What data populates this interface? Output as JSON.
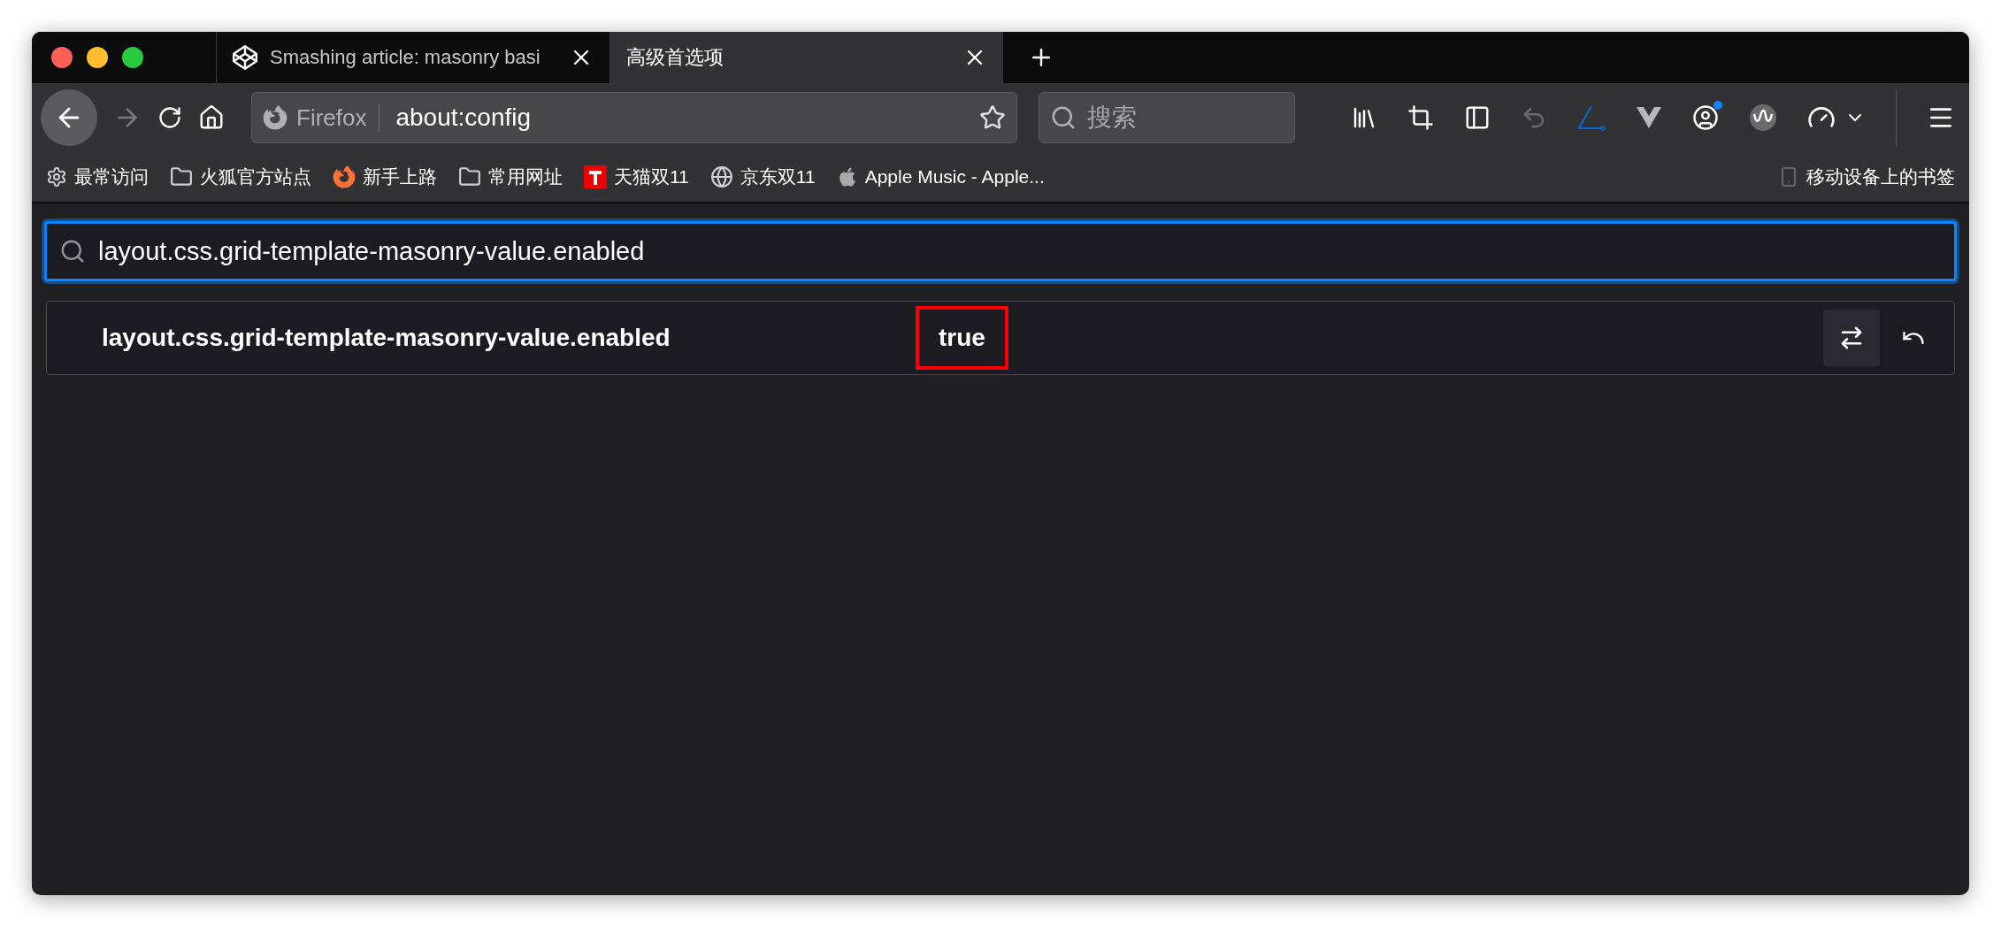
{
  "tabs": [
    {
      "title": "Smashing article: masonry basi",
      "selected": false,
      "kind": "codepen"
    },
    {
      "title": "高级首选项",
      "selected": true,
      "kind": "plain"
    }
  ],
  "url_bar": {
    "identity": "Firefox",
    "url": "about:config"
  },
  "search": {
    "placeholder": "搜索"
  },
  "bookmarks": [
    {
      "label": "最常访问",
      "kind": "settings"
    },
    {
      "label": "火狐官方站点",
      "kind": "folder"
    },
    {
      "label": "新手上路",
      "kind": "firefox"
    },
    {
      "label": "常用网址",
      "kind": "folder"
    },
    {
      "label": "天猫双11",
      "kind": "tmall"
    },
    {
      "label": "京东双11",
      "kind": "globe"
    },
    {
      "label": "Apple Music - Apple...",
      "kind": "apple"
    }
  ],
  "mobile_bookmarks": "移动设备上的书签",
  "config_search": {
    "value": "layout.css.grid-template-masonry-value.enabled"
  },
  "preferences": [
    {
      "name": "layout.css.grid-template-masonry-value.enabled",
      "value": "true",
      "value_highlighted": true
    }
  ]
}
